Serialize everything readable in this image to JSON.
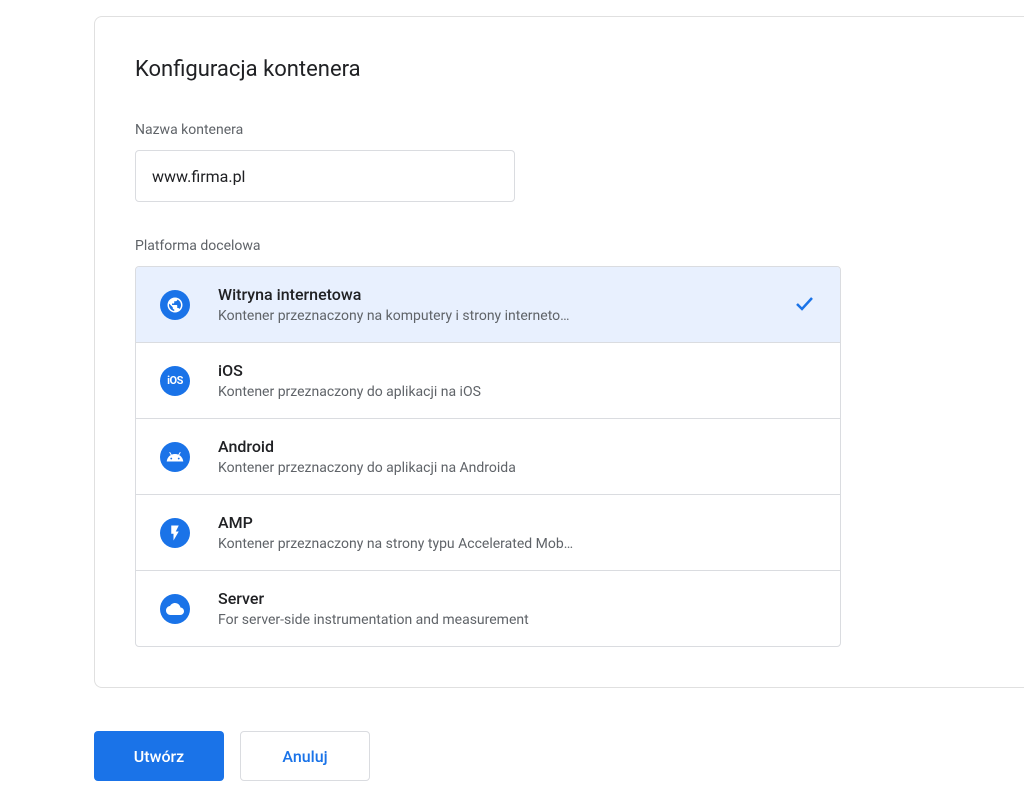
{
  "card": {
    "title": "Konfiguracja kontenera",
    "container_name_label": "Nazwa kontenera",
    "container_name_value": "www.firma.pl",
    "platform_label": "Platforma docelowa"
  },
  "platforms": [
    {
      "icon": "globe-icon",
      "title": "Witryna internetowa",
      "description": "Kontener przeznaczony na komputery i strony interneto…",
      "selected": true
    },
    {
      "icon": "ios-icon",
      "title": "iOS",
      "description": "Kontener przeznaczony do aplikacji na iOS",
      "selected": false
    },
    {
      "icon": "android-icon",
      "title": "Android",
      "description": "Kontener przeznaczony do aplikacji na Androida",
      "selected": false
    },
    {
      "icon": "amp-icon",
      "title": "AMP",
      "description": "Kontener przeznaczony na strony typu Accelerated Mob…",
      "selected": false
    },
    {
      "icon": "server-icon",
      "title": "Server",
      "description": "For server-side instrumentation and measurement",
      "selected": false
    }
  ],
  "buttons": {
    "create": "Utwórz",
    "cancel": "Anuluj"
  },
  "colors": {
    "primary": "#1a73e8",
    "selected_bg": "#e8f0fe",
    "text_primary": "#202124",
    "text_secondary": "#5f6368",
    "border": "#dadce0"
  }
}
